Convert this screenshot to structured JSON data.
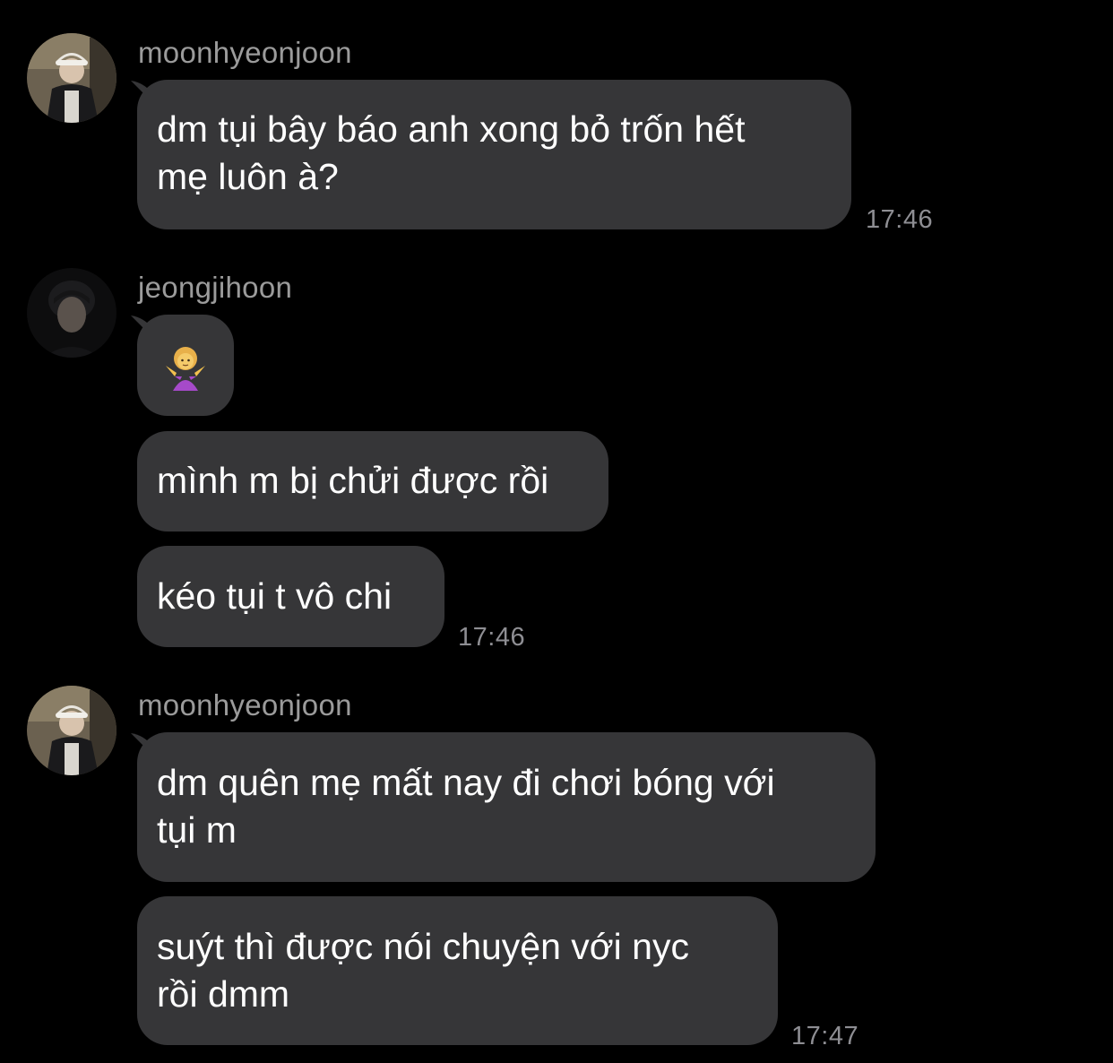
{
  "messages": [
    {
      "username": "moonhyeonjoon",
      "bubbles": [
        {
          "lines": [
            "dm tụi bây báo anh xong bỏ trốn hết",
            "mẹ luôn à?"
          ]
        }
      ],
      "time": "17:46"
    },
    {
      "username": "jeongjihoon",
      "bubbles": [
        {
          "emoji": "🤷‍♀️",
          "emoji_name": "woman-shrugging-emoji"
        },
        {
          "lines": [
            "mình m bị chửi được rồi"
          ]
        },
        {
          "lines": [
            "kéo tụi t vô chi"
          ]
        }
      ],
      "time": "17:46"
    },
    {
      "username": "moonhyeonjoon",
      "bubbles": [
        {
          "lines": [
            "dm quên mẹ mất nay đi chơi bóng với",
            "tụi m"
          ]
        },
        {
          "lines": [
            "suýt thì được nói chuyện với nyc",
            "rồi dmm"
          ]
        }
      ],
      "time": "17:47"
    }
  ],
  "colors": {
    "background": "#000000",
    "bubble": "#363638",
    "username": "#9b9b9b",
    "timestamp": "#8e8e93"
  }
}
